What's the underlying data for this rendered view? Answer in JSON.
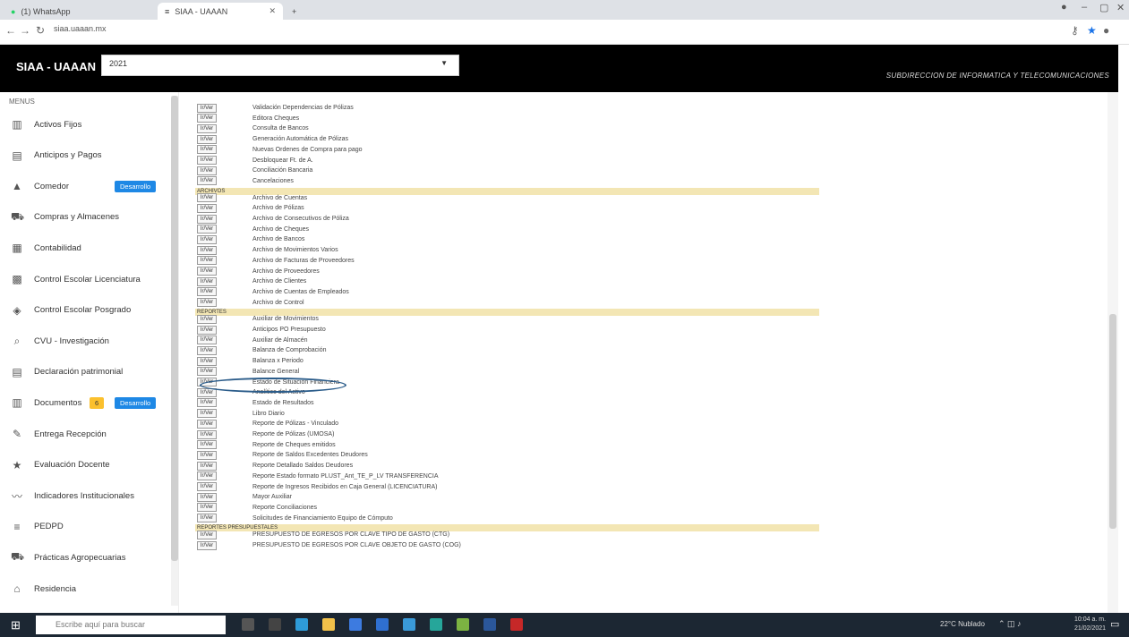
{
  "browser": {
    "tabs": [
      {
        "label": "(1) WhatsApp",
        "active": false
      },
      {
        "label": "SIAA - UAAAN",
        "active": true
      }
    ],
    "url": "siaa.uaaan.mx"
  },
  "header": {
    "brand": "SIAA - UAAAN",
    "year": "2021",
    "subtitle": "SUBDIRECCION DE INFORMATICA Y TELECOMUNICACIONES"
  },
  "sidebar": {
    "title": "MENUS",
    "items": [
      {
        "label": "Activos Fijos",
        "icon": "bank-icon"
      },
      {
        "label": "Anticipos y Pagos",
        "icon": "calendar-icon"
      },
      {
        "label": "Comedor",
        "icon": "food-icon",
        "badge": "Desarrollo"
      },
      {
        "label": "Compras y Almacenes",
        "icon": "cart-icon"
      },
      {
        "label": "Contabilidad",
        "icon": "ledger-icon"
      },
      {
        "label": "Control Escolar Licenciatura",
        "icon": "school-icon"
      },
      {
        "label": "Control Escolar Posgrado",
        "icon": "graduation-icon"
      },
      {
        "label": "CVU - Investigación",
        "icon": "search-icon"
      },
      {
        "label": "Declaración patrimonial",
        "icon": "document-icon"
      },
      {
        "label": "Documentos",
        "icon": "folder-icon",
        "badge_yellow": "6",
        "badge": "Desarrollo"
      },
      {
        "label": "Entrega Recepción",
        "icon": "signature-icon"
      },
      {
        "label": "Evaluación Docente",
        "icon": "star-icon"
      },
      {
        "label": "Indicadores Institucionales",
        "icon": "chart-icon"
      },
      {
        "label": "PEDPD",
        "icon": "list-icon"
      },
      {
        "label": "Prácticas Agropecuarias",
        "icon": "truck-icon"
      },
      {
        "label": "Residencia",
        "icon": "home-icon"
      }
    ]
  },
  "main": {
    "button_label": "Ir/Ver",
    "rows": [
      {
        "kind": "row",
        "text": "Validación Dependencias de Pólizas"
      },
      {
        "kind": "row",
        "text": "Editora Cheques"
      },
      {
        "kind": "row",
        "text": "Consulta de Bancos"
      },
      {
        "kind": "row",
        "text": "Generación Automática de Pólizas"
      },
      {
        "kind": "row",
        "text": "Nuevas Ordenes de Compra para pago"
      },
      {
        "kind": "row",
        "text": "Desbloquear Ft. de A."
      },
      {
        "kind": "row",
        "text": "Conciliación Bancaria"
      },
      {
        "kind": "row",
        "text": "Cancelaciones"
      },
      {
        "kind": "section",
        "text": "ARCHIVOS"
      },
      {
        "kind": "row",
        "text": "Archivo de Cuentas"
      },
      {
        "kind": "row",
        "text": "Archivo de Pólizas"
      },
      {
        "kind": "row",
        "text": "Archivo de Consecutivos de Póliza"
      },
      {
        "kind": "row",
        "text": "Archivo de Cheques"
      },
      {
        "kind": "row",
        "text": "Archivo de Bancos"
      },
      {
        "kind": "row",
        "text": "Archivo de Movimientos Varios"
      },
      {
        "kind": "row",
        "text": "Archivo de Facturas de Proveedores"
      },
      {
        "kind": "row",
        "text": "Archivo de Proveedores"
      },
      {
        "kind": "row",
        "text": "Archivo de Clientes"
      },
      {
        "kind": "row",
        "text": "Archivo de Cuentas de Empleados"
      },
      {
        "kind": "row",
        "text": "Archivo de Control"
      },
      {
        "kind": "section",
        "text": "REPORTES"
      },
      {
        "kind": "row",
        "text": "Auxiliar de Movimientos"
      },
      {
        "kind": "row",
        "text": "Anticipos PO Presupuesto"
      },
      {
        "kind": "row",
        "text": "Auxiliar de Almacén"
      },
      {
        "kind": "row",
        "text": "Balanza de Comprobación"
      },
      {
        "kind": "row",
        "text": "Balanza x Periodo"
      },
      {
        "kind": "row",
        "text": "Balance General"
      },
      {
        "kind": "row",
        "text": "Estado de Situación Financiera"
      },
      {
        "kind": "row",
        "text": "Analítico del Activo"
      },
      {
        "kind": "row",
        "text": "Estado de Resultados"
      },
      {
        "kind": "row",
        "text": "Libro Diario"
      },
      {
        "kind": "row",
        "text": "Reporte de Pólizas - Vinculado"
      },
      {
        "kind": "row",
        "text": "Reporte de Pólizas (UMOSA)"
      },
      {
        "kind": "row",
        "text": "Reporte de Cheques emitidos"
      },
      {
        "kind": "row",
        "text": "Reporte de Saldos Excedentes Deudores"
      },
      {
        "kind": "row",
        "text": "Reporte Detallado Saldos Deudores"
      },
      {
        "kind": "row",
        "text": "Reporte Estado formato PLUST_Ant_TE_P_LV TRANSFERENCIA"
      },
      {
        "kind": "row",
        "text": "Reporte de Ingresos Recibidos en Caja General (LICENCIATURA)"
      },
      {
        "kind": "row",
        "text": "Mayor Auxiliar"
      },
      {
        "kind": "row",
        "text": "Reporte Conciliaciones"
      },
      {
        "kind": "row",
        "text": "Solicitudes de Financiamiento Equipo de Cómputo"
      },
      {
        "kind": "section",
        "text": "REPORTES PRESUPUESTALES"
      },
      {
        "kind": "row",
        "text": "PRESUPUESTO DE EGRESOS POR CLAVE TIPO DE GASTO (CTG)"
      },
      {
        "kind": "row",
        "text": "PRESUPUESTO DE EGRESOS POR CLAVE OBJETO DE GASTO (COG)"
      }
    ],
    "highlighted_row": "Balanza de Comprobación"
  },
  "taskbar": {
    "search_placeholder": "Escribe aquí para buscar",
    "weather": "22°C Nublado",
    "time": "10:04 a. m.",
    "date": "21/02/2021"
  },
  "colors": {
    "header_bg": "#000000",
    "section_bg": "#f3e6b4",
    "badge_blue": "#1e88e5",
    "badge_yellow": "#fbc02d",
    "highlight_oval": "#2b5c8a"
  }
}
